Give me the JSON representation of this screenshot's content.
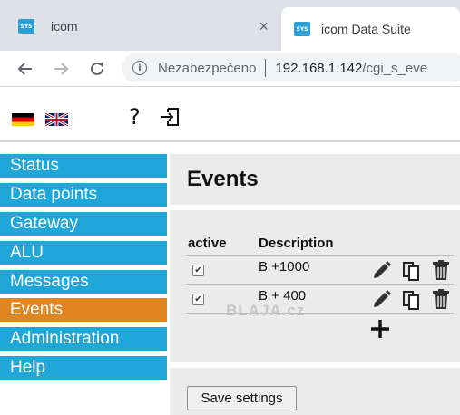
{
  "browser": {
    "tabs": [
      {
        "favicon": "icom-favicon",
        "favicon_text": "SYS",
        "title": "icom",
        "close": "×"
      },
      {
        "favicon": "icom-favicon",
        "favicon_text": "SYS",
        "title": "icom Data Suite"
      }
    ],
    "address": {
      "security_label": "Nezabezpečeno",
      "host": "192.168.1.142",
      "path": "/cgi_s_eve"
    }
  },
  "header": {
    "languages": [
      {
        "name": "German",
        "icon": "flag-de-icon"
      },
      {
        "name": "English",
        "icon": "flag-gb-icon"
      }
    ],
    "help_symbol": "?",
    "logout_icon": "logout-icon"
  },
  "sidebar": {
    "items": [
      {
        "label": "Status",
        "active": false
      },
      {
        "label": "Data points",
        "active": false
      },
      {
        "label": "Gateway",
        "active": false
      },
      {
        "label": "ALU",
        "active": false
      },
      {
        "label": "Messages",
        "active": false
      },
      {
        "label": "Events",
        "active": true
      },
      {
        "label": "Administration",
        "active": false
      },
      {
        "label": "Help",
        "active": false
      }
    ]
  },
  "main": {
    "title": "Events",
    "table": {
      "columns": [
        "active",
        "Description"
      ],
      "rows": [
        {
          "active": true,
          "description": "B +1000"
        },
        {
          "active": true,
          "description": "B + 400"
        }
      ],
      "row_actions": [
        "edit-icon",
        "copy-icon",
        "delete-icon"
      ],
      "add_icon": "add-icon"
    },
    "watermark": "BLAJA.cz",
    "save_button": "Save settings"
  },
  "colors": {
    "nav": "#1fa7d9",
    "nav_active": "#e0851f",
    "panel": "#ebebeb"
  }
}
